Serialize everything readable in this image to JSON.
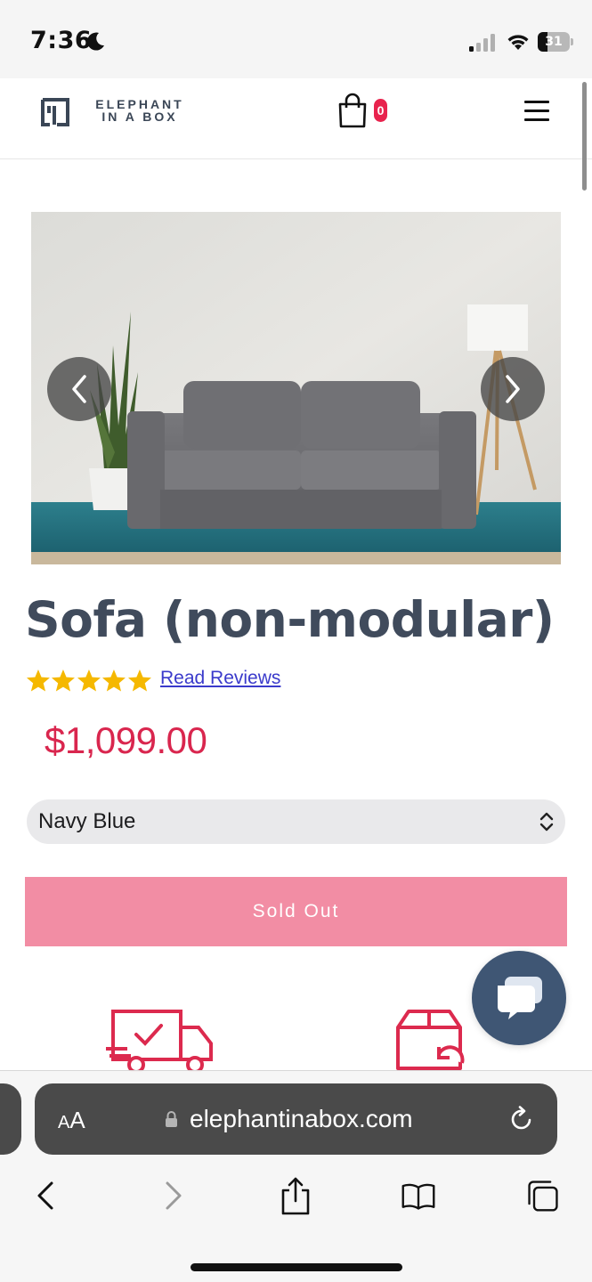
{
  "status_bar": {
    "time": "7:36",
    "battery": "31",
    "battery_level": 0.31
  },
  "header": {
    "logo_line1": "ELEPHANT",
    "logo_line2": "IN A BOX",
    "cart_count": "0"
  },
  "product": {
    "title": "Sofa (non-modular)",
    "rating_stars": 5,
    "reviews_link": "Read Reviews",
    "price": "$1,099.00",
    "variant": {
      "selected": "Navy Blue"
    },
    "sold_out_label": "Sold Out"
  },
  "browser": {
    "aa_big": "A",
    "aa_small": "A",
    "url": "elephantinabox.com"
  },
  "colors": {
    "brand_dark": "#404b5c",
    "price_red": "#d9264e",
    "sold_out_pink": "#f28da4",
    "chat_blue": "#3f5674",
    "star_gold": "#f5b800"
  }
}
